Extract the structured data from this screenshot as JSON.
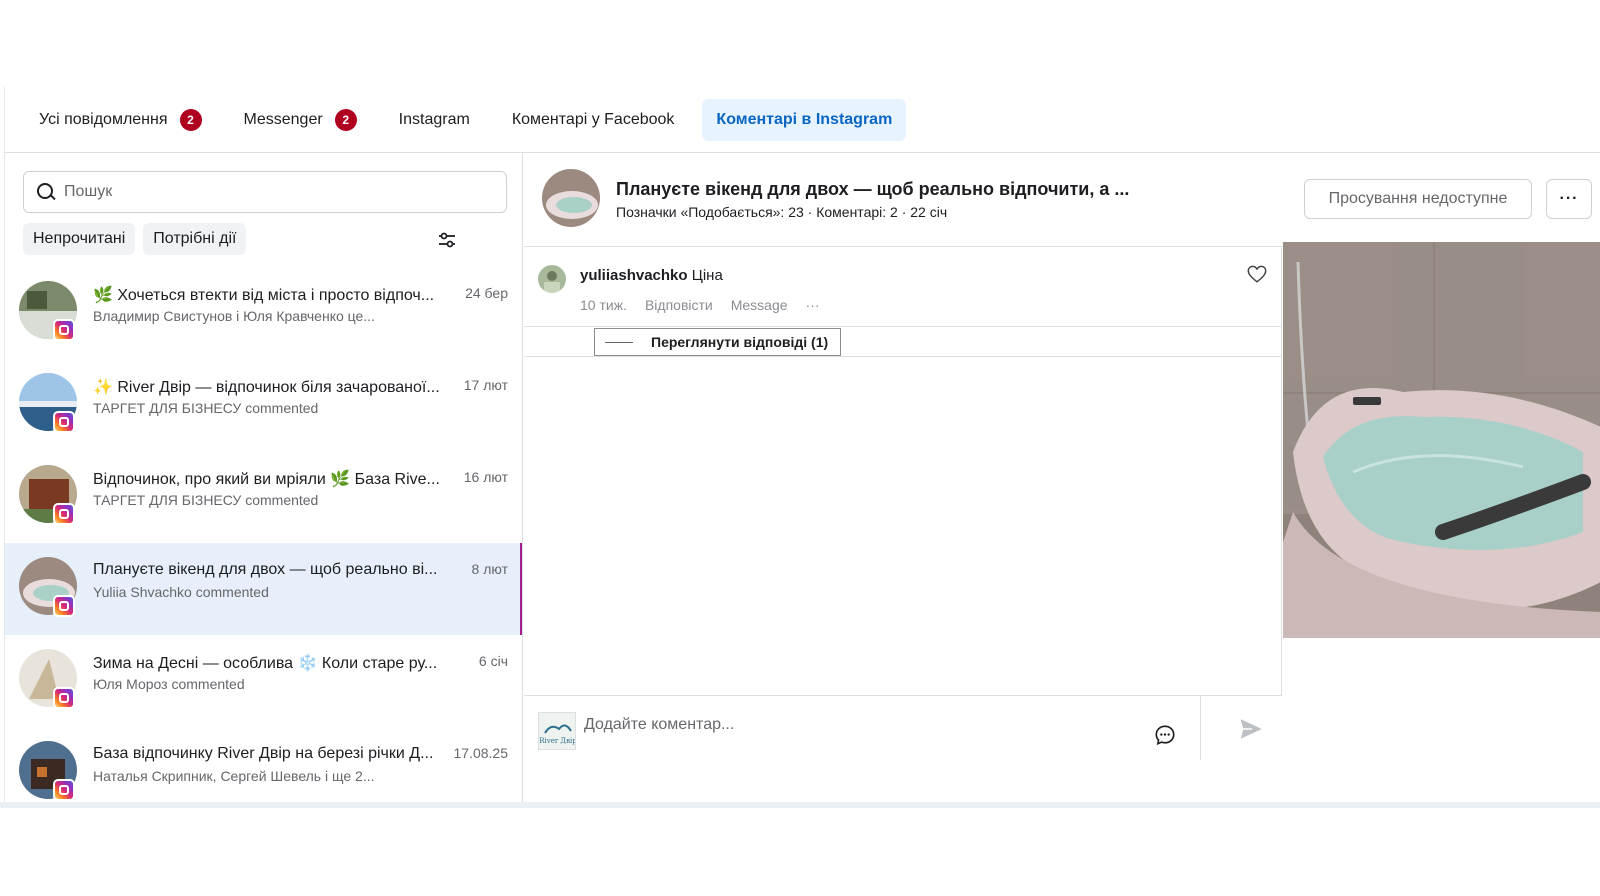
{
  "tabs": [
    {
      "label": "Усі повідомлення",
      "badge": "2"
    },
    {
      "label": "Messenger",
      "badge": "2"
    },
    {
      "label": "Instagram"
    },
    {
      "label": "Коментарі у Facebook"
    },
    {
      "label": "Коментарі в Instagram",
      "active": true
    }
  ],
  "search": {
    "placeholder": "Пошук"
  },
  "filters": {
    "unread": "Непрочитані",
    "action_needed": "Потрібні дії"
  },
  "conversations": [
    {
      "title": "🌿 Хочеться втекти від міста і просто відпоч...",
      "subtitle": "Владимир Свистунов і Юля Кравченко це...",
      "date": "24 бер"
    },
    {
      "title": "✨ River Двір — відпочинок біля зачарованої...",
      "subtitle": "ТАРГЕТ ДЛЯ БІЗНЕСУ commented",
      "date": "17 лют"
    },
    {
      "title": "Відпочинок, про який ви мріяли 🌿 База Rive...",
      "subtitle": "ТАРГЕТ ДЛЯ БІЗНЕСУ commented",
      "date": "16 лют"
    },
    {
      "title": "Плануєте вікенд для двох — щоб реально ві...",
      "subtitle": "Yuliia Shvachko commented",
      "date": "8 лют",
      "selected": true
    },
    {
      "title": "Зима на Десні — особлива ❄️ Коли старе ру...",
      "subtitle": "Юля Мороз commented",
      "date": "6 січ"
    },
    {
      "title": "База відпочинку River Двір на березі річки Д...",
      "subtitle": "Наталья Скрипник, Сергей Шевель і ще 2...",
      "date": "17.08.25"
    }
  ],
  "post": {
    "title": "Плануєте вікенд для двох — щоб реально відпочити, а ...",
    "meta": "Позначки «Подобається»: 23 · Коментарі: 2 · 22 січ",
    "promote_label": "Просування недоступне",
    "more_label": "···"
  },
  "comment": {
    "author": "yuliiashvachko",
    "text": "Ціна",
    "time": "10 тиж.",
    "reply": "Відповісти",
    "message": "Message",
    "more": "···"
  },
  "replies": {
    "label": "Переглянути відповіді (1)"
  },
  "composer": {
    "placeholder": "Додайте коментар...",
    "avatar_text": "River Двір"
  },
  "colors": {
    "accent": "#0a66c2",
    "active_tab_bg": "#e7f3ff",
    "badge": "#b00020",
    "selected_row": "#e7f0fa",
    "selected_border": "#a21c8a"
  }
}
